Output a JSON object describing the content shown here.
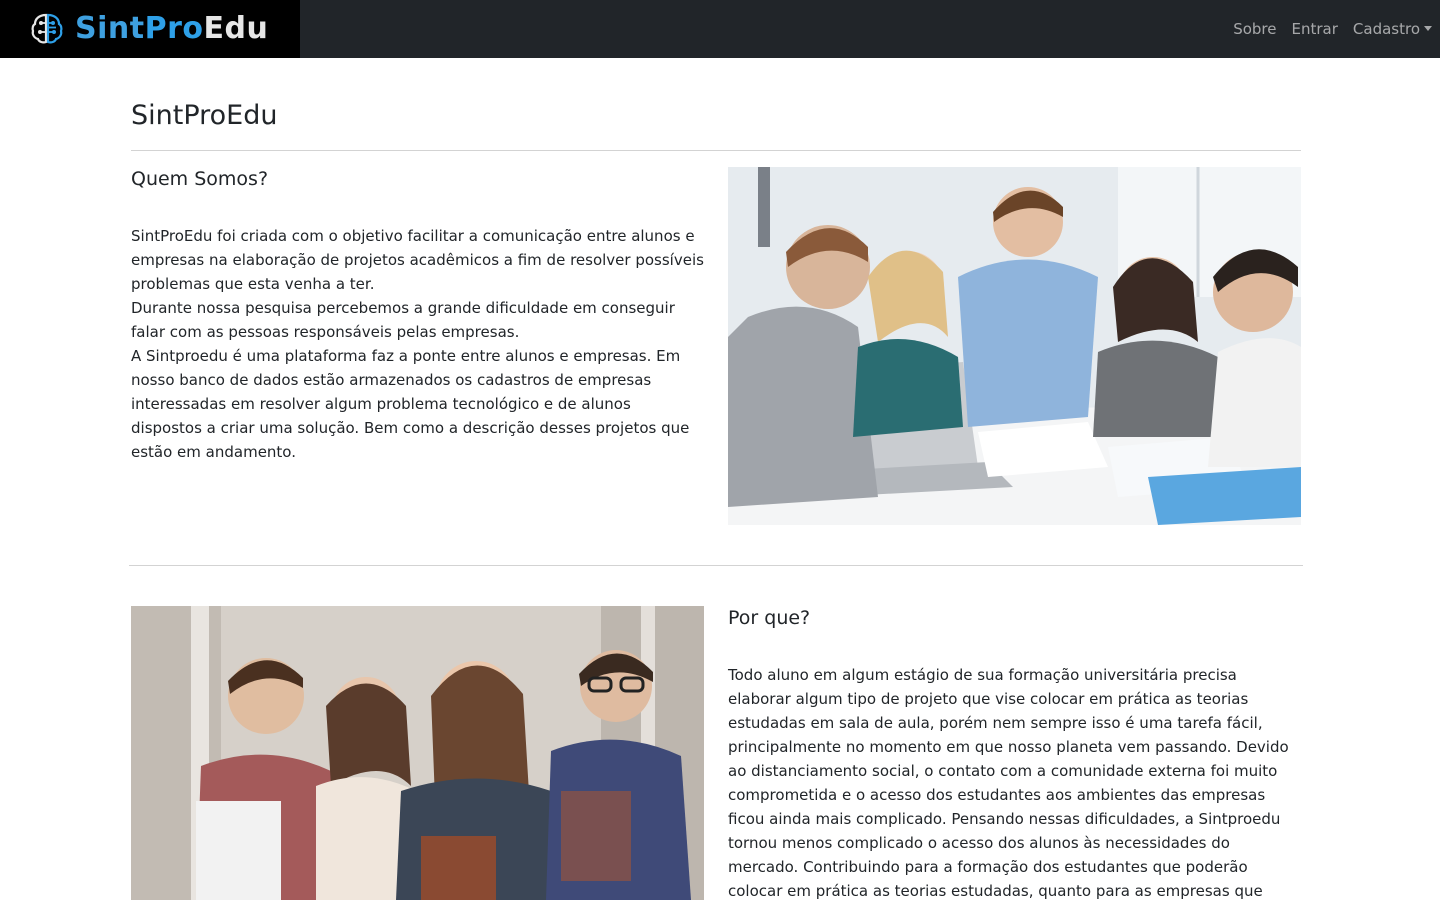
{
  "navbar": {
    "brand_parts": {
      "sint": "Sint",
      "pro": "Pro",
      "edu": "Edu"
    },
    "links": [
      {
        "label": "Sobre"
      },
      {
        "label": "Entrar"
      },
      {
        "label": "Cadastro"
      }
    ],
    "bg_color": "#212529",
    "brand_bg_color": "#000000",
    "accent_color": "#2ea0e8"
  },
  "page": {
    "title": "SintProEdu"
  },
  "quem_somos": {
    "heading": "Quem Somos?",
    "paragraphs": [
      "SintProEdu foi criada com o objetivo facilitar a comunicação entre alunos e empresas na elaboração de projetos acadêmicos a fim de resolver possíveis problemas que esta venha a ter.",
      "Durante nossa pesquisa percebemos a grande dificuldade em conseguir falar com as pessoas responsáveis pelas empresas.",
      "A Sintproedu é uma plataforma faz a ponte entre alunos e empresas. Em nosso banco de dados estão armazenados os cadastros de empresas interessadas em resolver algum problema tecnológico e de alunos dispostos a criar uma solução. Bem como a descrição desses projetos que estão em andamento."
    ],
    "image": "students-working-at-table-photo"
  },
  "por_que": {
    "heading": "Por que?",
    "paragraphs": [
      "Todo aluno em algum estágio de sua formação universitária precisa elaborar algum tipo de projeto que vise colocar em prática as teorias estudadas em sala de aula, porém nem sempre isso é uma tarefa fácil, principalmente no momento em que nosso planeta vem passando. Devido ao distanciamento social, o contato com a comunidade externa foi muito comprometida e o acesso dos estudantes aos ambientes das empresas ficou ainda mais complicado. Pensando nessas dificuldades, a Sintproedu tornou menos complicado o acesso dos alunos às necessidades do mercado. Contribuindo para a formação dos estudantes que poderão colocar em prática as teorias estudadas, quanto para as empresas que terão ajuda na resolução de seus problemas."
    ],
    "image": "smiling-students-holding-books-photo"
  }
}
